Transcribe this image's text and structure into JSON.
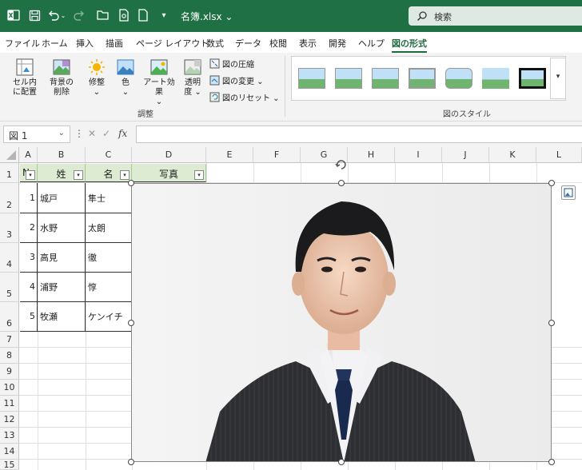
{
  "titlebar": {
    "filename": "名簿.xlsx",
    "search_placeholder": "検索",
    "colors": {
      "background": "#1f7145"
    }
  },
  "menu": {
    "items": [
      "ファイル",
      "ホーム",
      "挿入",
      "描画",
      "ページ レイアウト",
      "数式",
      "データ",
      "校閲",
      "表示",
      "開発",
      "ヘルプ",
      "図の形式"
    ],
    "active_index": 11
  },
  "ribbon": {
    "adjust_group": {
      "label": "調整",
      "buttons": [
        {
          "label": "セル内\nに配置",
          "icon": "place-in-cell-icon"
        },
        {
          "label": "背景の\n削除",
          "icon": "remove-background-icon"
        },
        {
          "label": "修整\n⌄",
          "icon": "corrections-icon"
        },
        {
          "label": "色\n⌄",
          "icon": "color-icon"
        },
        {
          "label": "アート効果\n⌄",
          "icon": "artistic-effects-icon"
        },
        {
          "label": "透明\n度 ⌄",
          "icon": "transparency-icon"
        }
      ],
      "small_buttons": [
        {
          "label": "図の圧縮",
          "icon": "compress-pictures-icon"
        },
        {
          "label": "図の変更 ⌄",
          "icon": "change-picture-icon"
        },
        {
          "label": "図のリセット ⌄",
          "icon": "reset-picture-icon"
        }
      ]
    },
    "styles_group": {
      "label": "図のスタイル",
      "thumb_count": 7
    }
  },
  "formula_bar": {
    "name_box": "図 1",
    "cancel_symbol": "✕",
    "enter_symbol": "✓",
    "fx_symbol": "fx"
  },
  "sheet": {
    "columns": [
      "A",
      "B",
      "C",
      "D",
      "E",
      "F",
      "G",
      "H",
      "I",
      "J",
      "K",
      "L"
    ],
    "rows": [
      "1",
      "2",
      "3",
      "4",
      "5",
      "6",
      "7",
      "8",
      "9",
      "10",
      "11",
      "12",
      "13",
      "14",
      "15"
    ],
    "table": {
      "headers": [
        "No",
        "姓",
        "名",
        "写真"
      ],
      "rows": [
        {
          "no": "1",
          "last": "城戸",
          "first": "隼士"
        },
        {
          "no": "2",
          "last": "水野",
          "first": "太朗"
        },
        {
          "no": "3",
          "last": "高見",
          "first": "徹"
        },
        {
          "no": "4",
          "last": "浦野",
          "first": "惇"
        },
        {
          "no": "5",
          "last": "牧瀬",
          "first": "ケンイチ"
        }
      ],
      "header_color": "#ddebd3"
    }
  },
  "image": {
    "icon": "portrait-photo"
  }
}
